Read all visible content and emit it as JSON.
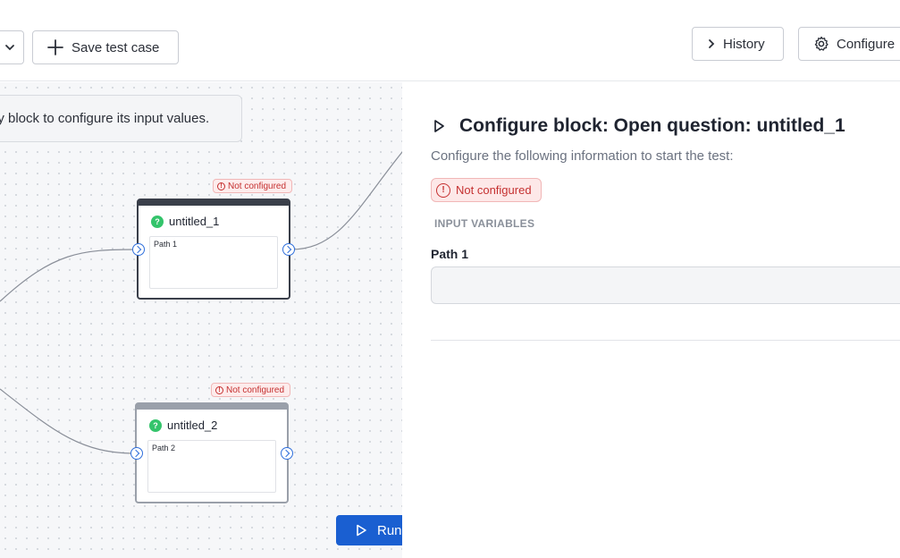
{
  "toolbar": {
    "save_label": "Save test case",
    "history_label": "History",
    "configure_label": "Configure"
  },
  "canvas": {
    "hint": "ny block to configure its input values.",
    "nodes": [
      {
        "title": "untitled_1",
        "body": "Path 1",
        "status": "Not configured"
      },
      {
        "title": "untitled_2",
        "body": "Path 2",
        "status": "Not configured"
      }
    ],
    "run_label": "Run test"
  },
  "panel": {
    "title": "Configure block: Open question: untitled_1",
    "subtitle": "Configure the following information to start the test:",
    "status": "Not configured",
    "section": "INPUT VARIABLES",
    "field_label": "Path 1",
    "field_value": ""
  },
  "colors": {
    "accent": "#1a5fd1",
    "error": "#c53030",
    "node_icon": "#34c46b"
  },
  "icons": {
    "dropdown": "chevron-down-icon",
    "save": "plus-icon",
    "history": "chevron-right-icon",
    "configure": "gear-icon",
    "run": "play-icon",
    "status": "alert-circle-icon",
    "node": "question-bubble-icon"
  }
}
